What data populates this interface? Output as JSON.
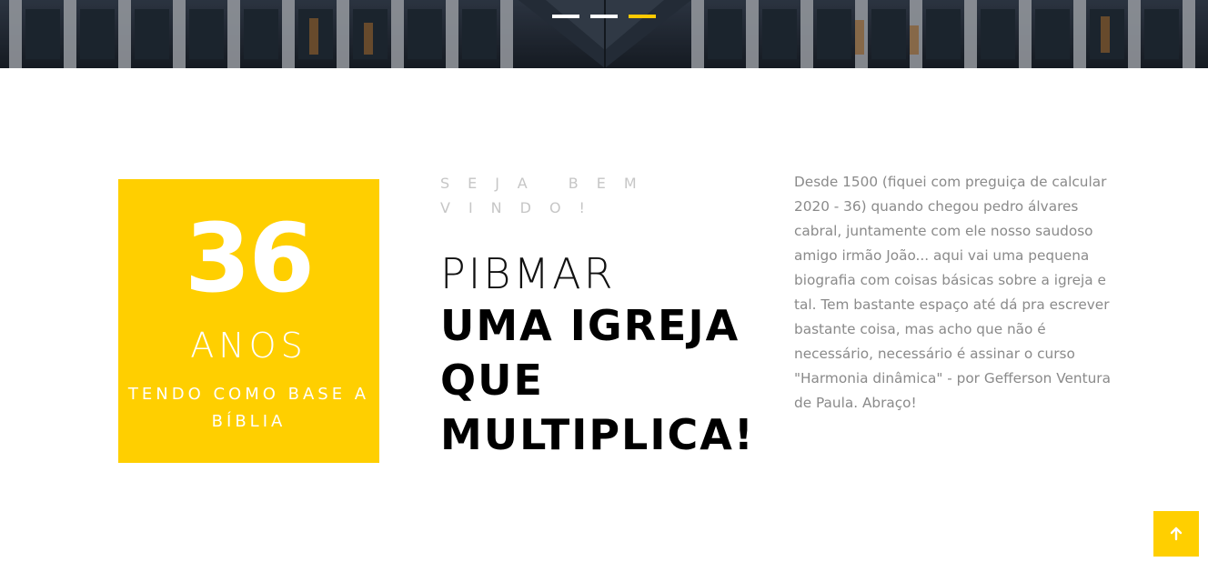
{
  "hero": {
    "slides": [
      {
        "active": false
      },
      {
        "active": false
      },
      {
        "active": true
      }
    ],
    "active_color": "#ffc900",
    "inactive_color": "#ffffff"
  },
  "years_box": {
    "number": "36",
    "unit": "ANOS",
    "caption": "TENDO COMO BASE A BÍBLIA",
    "background_color": "#ffcf00"
  },
  "welcome": {
    "subtitle": "SEJA BEM VINDO!",
    "brand": "PIBMAR",
    "tagline": "UMA IGREJA QUE MULTIPLICA!"
  },
  "about": {
    "text": "Desde 1500 (fiquei com preguiça de calcular 2020 - 36) quando chegou pedro álvares cabral, juntamente com ele nosso saudoso amigo irmão João... aqui vai uma pequena biografia com coisas básicas sobre a igreja e tal. Tem bastante espaço até dá pra escrever bastante coisa, mas acho que não é necessário, necessário é assinar o curso \"Harmonia dinâmica\" - por Gefferson Ventura de Paula. Abraço!"
  },
  "back_to_top": {
    "icon": "arrow-up-icon",
    "color": "#ffcf00"
  }
}
